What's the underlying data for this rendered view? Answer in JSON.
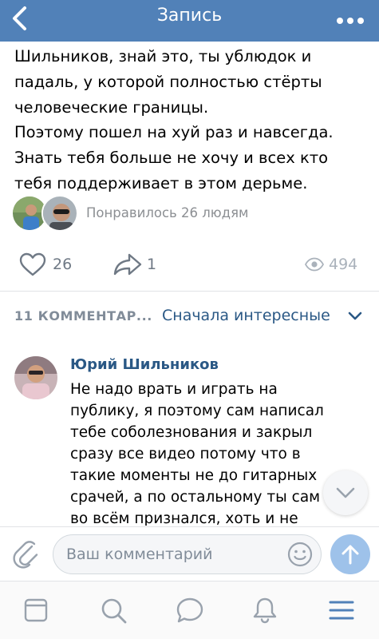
{
  "navbar": {
    "title": "Запись",
    "back_icon": "chevron-left-icon",
    "more_icon": "more-horizontal-icon",
    "color": "#5181b8"
  },
  "post": {
    "text": "Шильников, знай это, ты ублюдок и\nпадаль, у которой полностью стёрты\nчеловеческие границы.\nПоэтому пошел на хуй раз и навсегда.\nЗнать тебя больше не хочу и всех кто\nтебя поддерживает в этом дерьме.",
    "liked_by_text": "Понравилось 26 людям",
    "likes_count": "26",
    "reposts_count": "1",
    "views_count": "494"
  },
  "comments": {
    "count_label": "11 КОММЕНТАР...",
    "sort_label": "Сначала интересные",
    "items": [
      {
        "author": "Юрий Шильников",
        "text": "Не надо врать и играть на публику, я поэтому сам написал тебе соболезнования и закрыл сразу все видео потому что в такие моменты не до гитарных срачей, а по остальному ты сам во всём признался, хоть и не публично."
      }
    ]
  },
  "composer": {
    "placeholder": "Ваш комментарий"
  },
  "colors": {
    "accent": "#5181b8",
    "link": "#2a5885",
    "secondary_text": "#818c99",
    "send_button": "#9ec2ea"
  },
  "tabbar": {
    "tabs": [
      "news-icon",
      "search-icon",
      "messages-icon",
      "notifications-icon",
      "menu-icon"
    ]
  }
}
